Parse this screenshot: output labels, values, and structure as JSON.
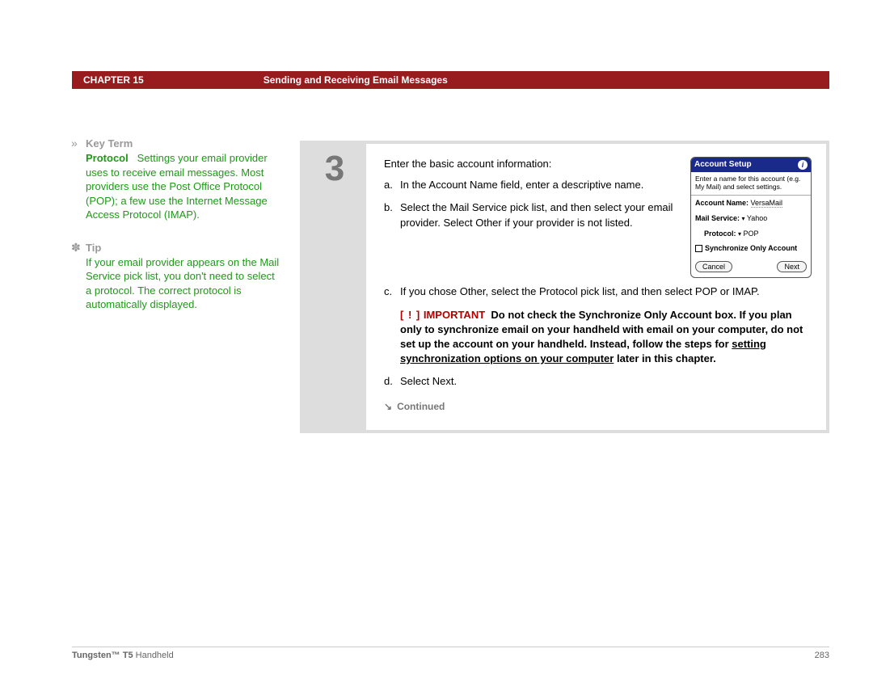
{
  "header": {
    "chapter_label": "CHAPTER 15",
    "chapter_title": "Sending and Receiving Email Messages"
  },
  "sidebar": {
    "keyterm": {
      "marker": "»",
      "label": "Key Term",
      "term": "Protocol",
      "body": "Settings your email provider uses to receive email messages. Most providers use the Post Office Protocol (POP); a few use the Internet Message Access Protocol (IMAP)."
    },
    "tip": {
      "marker": "✽",
      "label": "Tip",
      "body": "If your email provider appears on the Mail Service pick list, you don't need to select a protocol. The correct protocol is automatically displayed."
    }
  },
  "step": {
    "number": "3",
    "intro": "Enter the basic account information:",
    "items": {
      "a": {
        "lbl": "a.",
        "txt": "In the Account Name field, enter a descriptive name."
      },
      "b": {
        "lbl": "b.",
        "txt": "Select the Mail Service pick list, and then select your email provider. Select Other if your provider is not listed."
      },
      "c": {
        "lbl": "c.",
        "txt": "If you chose Other, select the Protocol pick list, and then select POP or IMAP."
      },
      "d": {
        "lbl": "d.",
        "txt": "Select Next."
      }
    },
    "important": {
      "mark": "[ ! ]",
      "word": "IMPORTANT",
      "body_before": "Do not check the Synchronize Only Account box. If you plan only to synchronize email on your handheld with email on your computer, do not set up the account on your handheld. Instead, follow the steps for ",
      "link": "setting synchronization options on your computer",
      "body_after": " later in this chapter."
    },
    "continued": {
      "arrow": "↘",
      "label": "Continued"
    }
  },
  "device": {
    "title": "Account Setup",
    "info": "i",
    "hint": "Enter a name for this account (e.g. My Mail) and select settings.",
    "account_name_label": "Account Name:",
    "account_name_value": "VersaMail",
    "mail_service_label": "Mail Service:",
    "mail_service_value": "Yahoo",
    "protocol_label": "Protocol:",
    "protocol_value": "POP",
    "sync_label": "Synchronize Only Account",
    "cancel": "Cancel",
    "next": "Next",
    "dropdown": "▾"
  },
  "footer": {
    "product_bold": "Tungsten™ T5",
    "product_rest": " Handheld",
    "page": "283"
  }
}
